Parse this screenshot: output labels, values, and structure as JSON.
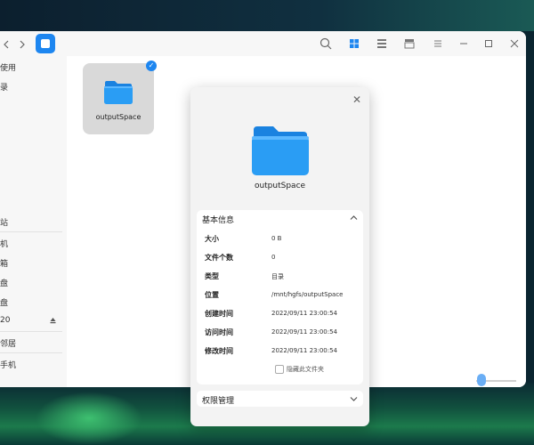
{
  "sidebar": {
    "items": [
      {
        "label": "使用",
        "icon": "recent-icon"
      },
      {
        "label": "录",
        "icon": "home-icon"
      },
      {
        "label": "站",
        "icon": "trash-icon"
      },
      {
        "label": "机",
        "icon": "computer-icon"
      },
      {
        "label": "箱",
        "icon": "vault-icon"
      },
      {
        "label": "盘",
        "icon": "disk-icon"
      },
      {
        "label": "盘",
        "icon": "disk-icon"
      },
      {
        "label": "20",
        "icon": "usb-disk-icon"
      },
      {
        "label": "邻居",
        "icon": "network-icon"
      },
      {
        "label": "手机",
        "icon": "phone-icon"
      }
    ]
  },
  "content": {
    "folder": {
      "name": "outputSpace",
      "selected": true
    }
  },
  "dialog": {
    "name": "outputSpace",
    "basic_info_header": "基本信息",
    "rows": [
      {
        "key": "大小",
        "value": "0 B"
      },
      {
        "key": "文件个数",
        "value": "0"
      },
      {
        "key": "类型",
        "value": "目录"
      },
      {
        "key": "位置",
        "value": "/mnt/hgfs/outputSpace"
      },
      {
        "key": "创建时间",
        "value": "2022/09/11 23:00:54"
      },
      {
        "key": "访问时间",
        "value": "2022/09/11 23:00:54"
      },
      {
        "key": "修改时间",
        "value": "2022/09/11 23:00:54"
      }
    ],
    "hide_label": "隐藏此文件夹",
    "permissions_header": "权限管理"
  },
  "colors": {
    "accent": "#1d86f0",
    "folder": "#2a9df4"
  }
}
